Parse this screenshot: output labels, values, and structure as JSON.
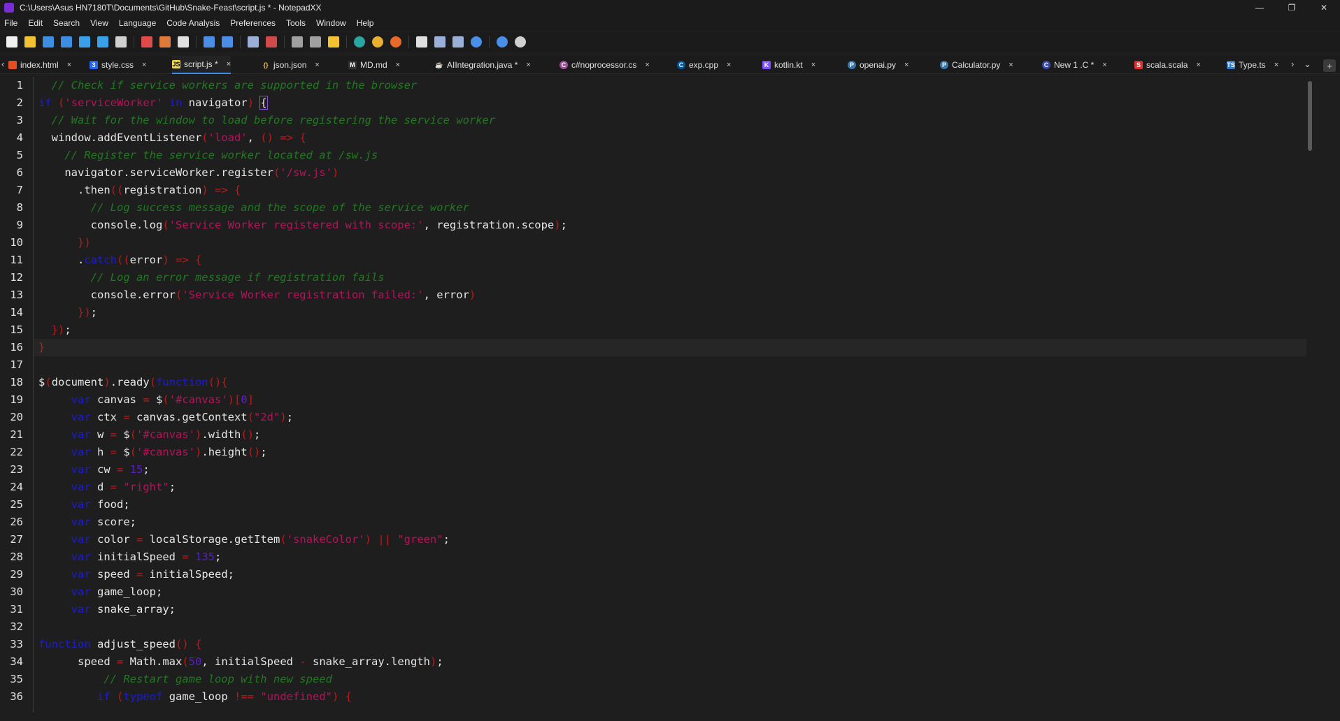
{
  "window": {
    "title": "C:\\Users\\Asus HN7180T\\Documents\\GitHub\\Snake-Feast\\script.js * - NotepadXX",
    "minimize": "—",
    "maximize": "❐",
    "close": "✕"
  },
  "menu": [
    "File",
    "Edit",
    "Search",
    "View",
    "Language",
    "Code Analysis",
    "Preferences",
    "Tools",
    "Window",
    "Help"
  ],
  "toolbar_icons": [
    "new-file-icon",
    "open-folder-icon",
    "save-icon",
    "save-all-icon",
    "close-file-icon",
    "close-all-icon",
    "print-icon",
    "cut-icon",
    "copy-icon",
    "paste-icon",
    "undo-icon",
    "redo-icon",
    "find-icon",
    "replace-icon",
    "run-icon",
    "terminal-icon",
    "folder-icon",
    "edge-icon",
    "chrome-icon",
    "firefox-icon",
    "document-icon",
    "zoom-in-icon",
    "zoom-out-icon",
    "sync-icon",
    "settings-icon",
    "refresh-icon"
  ],
  "tabs": [
    {
      "label": "index.html",
      "icon": "html-icon",
      "active": false
    },
    {
      "label": "style.css",
      "icon": "css-icon",
      "active": false
    },
    {
      "label": "script.js *",
      "icon": "js-icon",
      "active": true
    },
    {
      "label": "json.json",
      "icon": "json-icon",
      "active": false
    },
    {
      "label": "MD.md",
      "icon": "markdown-icon",
      "active": false
    },
    {
      "label": "AIIntegration.java *",
      "icon": "java-icon",
      "active": false
    },
    {
      "label": "c#noprocessor.cs",
      "icon": "csharp-icon",
      "active": false
    },
    {
      "label": "exp.cpp",
      "icon": "cpp-icon",
      "active": false
    },
    {
      "label": "kotlin.kt",
      "icon": "kotlin-icon",
      "active": false
    },
    {
      "label": "openai.py",
      "icon": "python-icon",
      "active": false
    },
    {
      "label": "Calculator.py",
      "icon": "python-icon",
      "active": false
    },
    {
      "label": "New 1 .C *",
      "icon": "c-icon",
      "active": false
    },
    {
      "label": "scala.scala",
      "icon": "scala-icon",
      "active": false
    },
    {
      "label": "Type.ts",
      "icon": "typescript-icon",
      "active": false
    }
  ],
  "tab_close": "×",
  "tab_new": "+",
  "current_line": 16,
  "colors": {
    "comment": "#1f7a1f",
    "keyword": "#1b1bd9",
    "string": "#b5135a",
    "number": "#5b1bd0",
    "operator": "#c01818",
    "background": "#1e1e1e",
    "accent": "#3b8eea"
  },
  "code_lines": [
    [
      [
        "c-com",
        "  // Check if service workers are supported in the browser"
      ]
    ],
    [
      [
        "c-kw",
        "if"
      ],
      [
        "c-plain",
        " "
      ],
      [
        "c-paren",
        "("
      ],
      [
        "c-str",
        "'serviceWorker'"
      ],
      [
        "c-plain",
        " "
      ],
      [
        "c-kw",
        "in"
      ],
      [
        "c-plain",
        " navigator"
      ],
      [
        "c-paren",
        ")"
      ],
      [
        "c-plain",
        " "
      ],
      [
        "c-cursor",
        "{"
      ]
    ],
    [
      [
        "c-com",
        "  // Wait for the window to load before registering the service worker"
      ]
    ],
    [
      [
        "c-plain",
        "  window.addEventListener"
      ],
      [
        "c-paren",
        "("
      ],
      [
        "c-str",
        "'load'"
      ],
      [
        "c-plain",
        ", "
      ],
      [
        "c-paren",
        "()"
      ],
      [
        "c-plain",
        " "
      ],
      [
        "c-op",
        "=>"
      ],
      [
        "c-plain",
        " "
      ],
      [
        "c-paren",
        "{"
      ]
    ],
    [
      [
        "c-com",
        "    // Register the service worker located at /sw.js"
      ]
    ],
    [
      [
        "c-plain",
        "    navigator.serviceWorker.register"
      ],
      [
        "c-paren",
        "("
      ],
      [
        "c-str",
        "'/sw.js'"
      ],
      [
        "c-paren",
        ")"
      ]
    ],
    [
      [
        "c-plain",
        "      .then"
      ],
      [
        "c-paren",
        "(("
      ],
      [
        "c-plain",
        "registration"
      ],
      [
        "c-paren",
        ")"
      ],
      [
        "c-plain",
        " "
      ],
      [
        "c-op",
        "=>"
      ],
      [
        "c-plain",
        " "
      ],
      [
        "c-paren",
        "{"
      ]
    ],
    [
      [
        "c-com",
        "        // Log success message and the scope of the service worker"
      ]
    ],
    [
      [
        "c-plain",
        "        console.log"
      ],
      [
        "c-paren",
        "("
      ],
      [
        "c-str",
        "'Service Worker registered with scope:'"
      ],
      [
        "c-plain",
        ", registration.scope"
      ],
      [
        "c-paren",
        ")"
      ],
      [
        "c-plain",
        ";"
      ]
    ],
    [
      [
        "c-paren",
        "      })"
      ]
    ],
    [
      [
        "c-plain",
        "      ."
      ],
      [
        "c-kw",
        "catch"
      ],
      [
        "c-paren",
        "(("
      ],
      [
        "c-plain",
        "error"
      ],
      [
        "c-paren",
        ")"
      ],
      [
        "c-plain",
        " "
      ],
      [
        "c-op",
        "=>"
      ],
      [
        "c-plain",
        " "
      ],
      [
        "c-paren",
        "{"
      ]
    ],
    [
      [
        "c-com",
        "        // Log an error message if registration fails"
      ]
    ],
    [
      [
        "c-plain",
        "        console.error"
      ],
      [
        "c-paren",
        "("
      ],
      [
        "c-str",
        "'Service Worker registration failed:'"
      ],
      [
        "c-plain",
        ", error"
      ],
      [
        "c-paren",
        ")"
      ]
    ],
    [
      [
        "c-paren",
        "      })"
      ],
      [
        "c-plain",
        ";"
      ]
    ],
    [
      [
        "c-paren",
        "  })"
      ],
      [
        "c-plain",
        ";"
      ]
    ],
    [
      [
        "c-paren",
        "}"
      ]
    ],
    [
      [
        "c-plain",
        ""
      ]
    ],
    [
      [
        "c-plain",
        "$"
      ],
      [
        "c-paren",
        "("
      ],
      [
        "c-plain",
        "document"
      ],
      [
        "c-paren",
        ")"
      ],
      [
        "c-plain",
        ".ready"
      ],
      [
        "c-paren",
        "("
      ],
      [
        "c-kw",
        "function"
      ],
      [
        "c-paren",
        "(){"
      ]
    ],
    [
      [
        "c-plain",
        "     "
      ],
      [
        "c-kw",
        "var"
      ],
      [
        "c-plain",
        " canvas "
      ],
      [
        "c-op",
        "="
      ],
      [
        "c-plain",
        " $"
      ],
      [
        "c-paren",
        "("
      ],
      [
        "c-str",
        "'#canvas'"
      ],
      [
        "c-paren",
        ")["
      ],
      [
        "c-num",
        "0"
      ],
      [
        "c-paren",
        "]"
      ]
    ],
    [
      [
        "c-plain",
        "     "
      ],
      [
        "c-kw",
        "var"
      ],
      [
        "c-plain",
        " ctx "
      ],
      [
        "c-op",
        "="
      ],
      [
        "c-plain",
        " canvas.getContext"
      ],
      [
        "c-paren",
        "("
      ],
      [
        "c-str",
        "\"2d\""
      ],
      [
        "c-paren",
        ")"
      ],
      [
        "c-plain",
        ";"
      ]
    ],
    [
      [
        "c-plain",
        "     "
      ],
      [
        "c-kw",
        "var"
      ],
      [
        "c-plain",
        " w "
      ],
      [
        "c-op",
        "="
      ],
      [
        "c-plain",
        " $"
      ],
      [
        "c-paren",
        "("
      ],
      [
        "c-str",
        "'#canvas'"
      ],
      [
        "c-paren",
        ")"
      ],
      [
        "c-plain",
        ".width"
      ],
      [
        "c-paren",
        "()"
      ],
      [
        "c-plain",
        ";"
      ]
    ],
    [
      [
        "c-plain",
        "     "
      ],
      [
        "c-kw",
        "var"
      ],
      [
        "c-plain",
        " h "
      ],
      [
        "c-op",
        "="
      ],
      [
        "c-plain",
        " $"
      ],
      [
        "c-paren",
        "("
      ],
      [
        "c-str",
        "'#canvas'"
      ],
      [
        "c-paren",
        ")"
      ],
      [
        "c-plain",
        ".height"
      ],
      [
        "c-paren",
        "()"
      ],
      [
        "c-plain",
        ";"
      ]
    ],
    [
      [
        "c-plain",
        "     "
      ],
      [
        "c-kw",
        "var"
      ],
      [
        "c-plain",
        " cw "
      ],
      [
        "c-op",
        "="
      ],
      [
        "c-plain",
        " "
      ],
      [
        "c-num",
        "15"
      ],
      [
        "c-plain",
        ";"
      ]
    ],
    [
      [
        "c-plain",
        "     "
      ],
      [
        "c-kw",
        "var"
      ],
      [
        "c-plain",
        " d "
      ],
      [
        "c-op",
        "="
      ],
      [
        "c-plain",
        " "
      ],
      [
        "c-str",
        "\"right\""
      ],
      [
        "c-plain",
        ";"
      ]
    ],
    [
      [
        "c-plain",
        "     "
      ],
      [
        "c-kw",
        "var"
      ],
      [
        "c-plain",
        " food;"
      ]
    ],
    [
      [
        "c-plain",
        "     "
      ],
      [
        "c-kw",
        "var"
      ],
      [
        "c-plain",
        " score;"
      ]
    ],
    [
      [
        "c-plain",
        "     "
      ],
      [
        "c-kw",
        "var"
      ],
      [
        "c-plain",
        " color "
      ],
      [
        "c-op",
        "="
      ],
      [
        "c-plain",
        " localStorage.getItem"
      ],
      [
        "c-paren",
        "("
      ],
      [
        "c-str",
        "'snakeColor'"
      ],
      [
        "c-paren",
        ")"
      ],
      [
        "c-plain",
        " "
      ],
      [
        "c-op",
        "||"
      ],
      [
        "c-plain",
        " "
      ],
      [
        "c-str",
        "\"green\""
      ],
      [
        "c-plain",
        ";"
      ]
    ],
    [
      [
        "c-plain",
        "     "
      ],
      [
        "c-kw",
        "var"
      ],
      [
        "c-plain",
        " initialSpeed "
      ],
      [
        "c-op",
        "="
      ],
      [
        "c-plain",
        " "
      ],
      [
        "c-num",
        "135"
      ],
      [
        "c-plain",
        ";"
      ]
    ],
    [
      [
        "c-plain",
        "     "
      ],
      [
        "c-kw",
        "var"
      ],
      [
        "c-plain",
        " speed "
      ],
      [
        "c-op",
        "="
      ],
      [
        "c-plain",
        " initialSpeed;"
      ]
    ],
    [
      [
        "c-plain",
        "     "
      ],
      [
        "c-kw",
        "var"
      ],
      [
        "c-plain",
        " game_loop;"
      ]
    ],
    [
      [
        "c-plain",
        "     "
      ],
      [
        "c-kw",
        "var"
      ],
      [
        "c-plain",
        " snake_array;"
      ]
    ],
    [
      [
        "c-plain",
        ""
      ]
    ],
    [
      [
        "c-kw",
        "function"
      ],
      [
        "c-plain",
        " adjust_speed"
      ],
      [
        "c-paren",
        "()"
      ],
      [
        "c-plain",
        " "
      ],
      [
        "c-paren",
        "{"
      ]
    ],
    [
      [
        "c-plain",
        "      speed "
      ],
      [
        "c-op",
        "="
      ],
      [
        "c-plain",
        " Math.max"
      ],
      [
        "c-paren",
        "("
      ],
      [
        "c-num",
        "50"
      ],
      [
        "c-plain",
        ", initialSpeed "
      ],
      [
        "c-op",
        "-"
      ],
      [
        "c-plain",
        " snake_array.length"
      ],
      [
        "c-paren",
        ")"
      ],
      [
        "c-plain",
        ";"
      ]
    ],
    [
      [
        "c-com",
        "          // Restart game loop with new speed"
      ]
    ],
    [
      [
        "c-plain",
        "         "
      ],
      [
        "c-kw",
        "if"
      ],
      [
        "c-plain",
        " "
      ],
      [
        "c-paren",
        "("
      ],
      [
        "c-kw",
        "typeof"
      ],
      [
        "c-plain",
        " game_loop "
      ],
      [
        "c-op",
        "!=="
      ],
      [
        "c-plain",
        " "
      ],
      [
        "c-str",
        "\"undefined\""
      ],
      [
        "c-paren",
        ")"
      ],
      [
        "c-plain",
        " "
      ],
      [
        "c-paren",
        "{"
      ]
    ]
  ]
}
